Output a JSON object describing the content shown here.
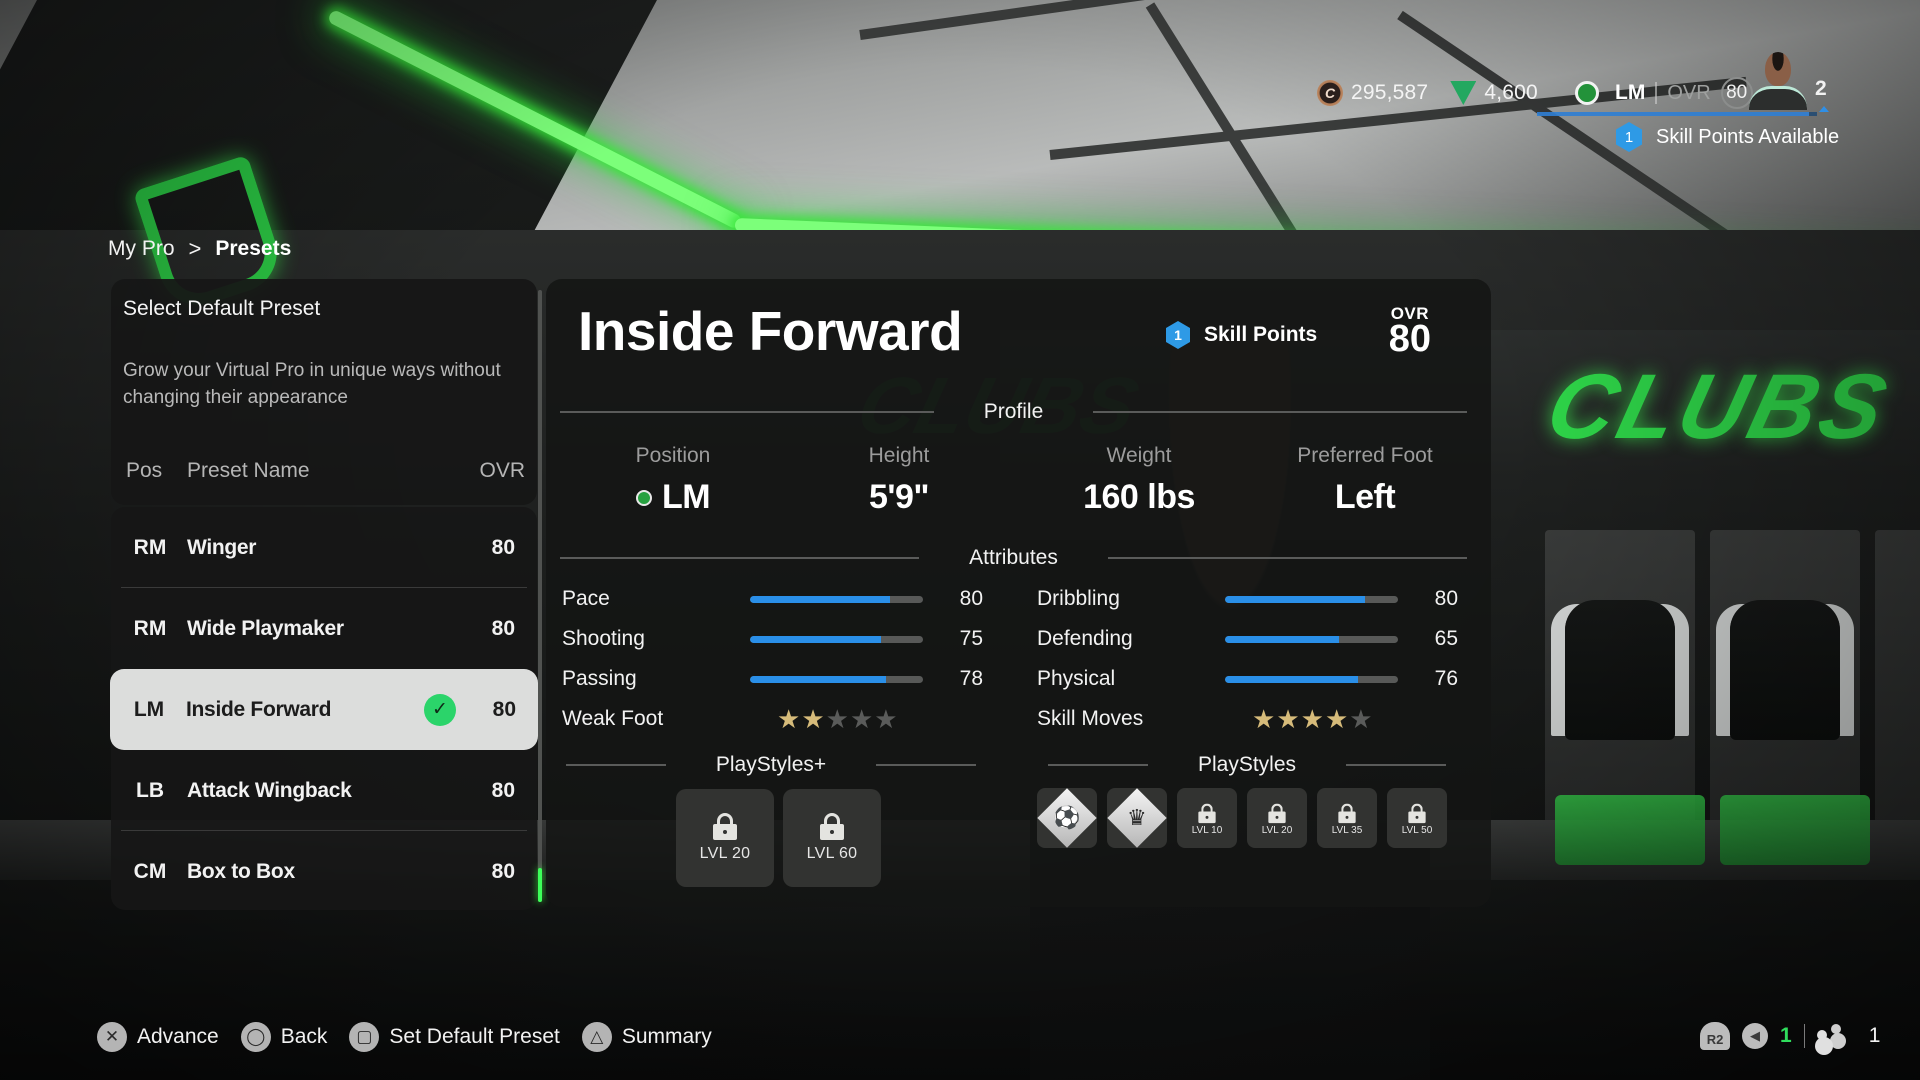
{
  "hud": {
    "coins": "295,587",
    "coin_icon": "clubs-coin-icon",
    "points": "4,600",
    "points_icon": "fc-points-icon",
    "position": "LM",
    "ovr_label": "OVR",
    "ovr_value": "80",
    "level": "2",
    "level_progress": 0.97,
    "skill_points_count": "1",
    "skill_points_available_label": "Skill Points Available"
  },
  "breadcrumb": {
    "parent": "My Pro",
    "separator": ">",
    "current": "Presets"
  },
  "left_panel": {
    "title": "Select Default Preset",
    "description": "Grow your Virtual Pro in unique ways without changing their appearance",
    "columns": {
      "pos": "Pos",
      "name": "Preset Name",
      "ovr": "OVR"
    },
    "presets": [
      {
        "pos": "RM",
        "name": "Winger",
        "ovr": "80",
        "selected": false
      },
      {
        "pos": "RM",
        "name": "Wide Playmaker",
        "ovr": "80",
        "selected": false
      },
      {
        "pos": "LM",
        "name": "Inside Forward",
        "ovr": "80",
        "selected": true,
        "badge": "check-icon"
      },
      {
        "pos": "LB",
        "name": "Attack Wingback",
        "ovr": "80",
        "selected": false
      },
      {
        "pos": "CM",
        "name": "Box to Box",
        "ovr": "80",
        "selected": false
      }
    ]
  },
  "main_panel": {
    "title": "Inside Forward",
    "skill_points_count": "1",
    "skill_points_label": "Skill Points",
    "ovr_label": "OVR",
    "ovr_value": "80",
    "profile_heading": "Profile",
    "profile": [
      {
        "label": "Position",
        "value": "LM",
        "dot_color": "#27a140"
      },
      {
        "label": "Height",
        "value": "5'9\""
      },
      {
        "label": "Weight",
        "value": "160 lbs"
      },
      {
        "label": "Preferred Foot",
        "value": "Left"
      }
    ],
    "attributes_heading": "Attributes",
    "attributes_left": [
      {
        "name": "Pace",
        "value": 80
      },
      {
        "name": "Shooting",
        "value": 75
      },
      {
        "name": "Passing",
        "value": 78
      }
    ],
    "attributes_right": [
      {
        "name": "Dribbling",
        "value": 80
      },
      {
        "name": "Defending",
        "value": 65
      },
      {
        "name": "Physical",
        "value": 76
      }
    ],
    "weak_foot": {
      "label": "Weak Foot",
      "stars": 2,
      "max": 5
    },
    "skill_moves": {
      "label": "Skill Moves",
      "stars": 4,
      "max": 5
    },
    "playstyles_plus_heading": "PlayStyles+",
    "playstyles_plus": [
      {
        "locked": true,
        "label": "LVL 20"
      },
      {
        "locked": true,
        "label": "LVL 60"
      }
    ],
    "playstyles_heading": "PlayStyles",
    "playstyles": [
      {
        "locked": false,
        "icon": "first-touch-playstyle-icon"
      },
      {
        "locked": false,
        "icon": "trickster-playstyle-icon"
      },
      {
        "locked": true,
        "label": "LVL 10"
      },
      {
        "locked": true,
        "label": "LVL 20"
      },
      {
        "locked": true,
        "label": "LVL 35"
      },
      {
        "locked": true,
        "label": "LVL 50"
      }
    ]
  },
  "button_hints": [
    {
      "button": "cross",
      "glyph": "✕",
      "label": "Advance"
    },
    {
      "button": "circle",
      "glyph": "◯",
      "label": "Back"
    },
    {
      "button": "square",
      "glyph": "▢",
      "label": "Set Default Preset"
    },
    {
      "button": "triangle",
      "glyph": "△",
      "label": "Summary"
    }
  ],
  "status": {
    "r2_label": "R2",
    "voice_count": "1",
    "party_count": "1"
  },
  "colors": {
    "accent_green": "#2bd46a",
    "bar_blue": "#2a8fe8",
    "star_gold": "#d6bb7a",
    "skill_hex_blue": "#2e9ae6"
  }
}
